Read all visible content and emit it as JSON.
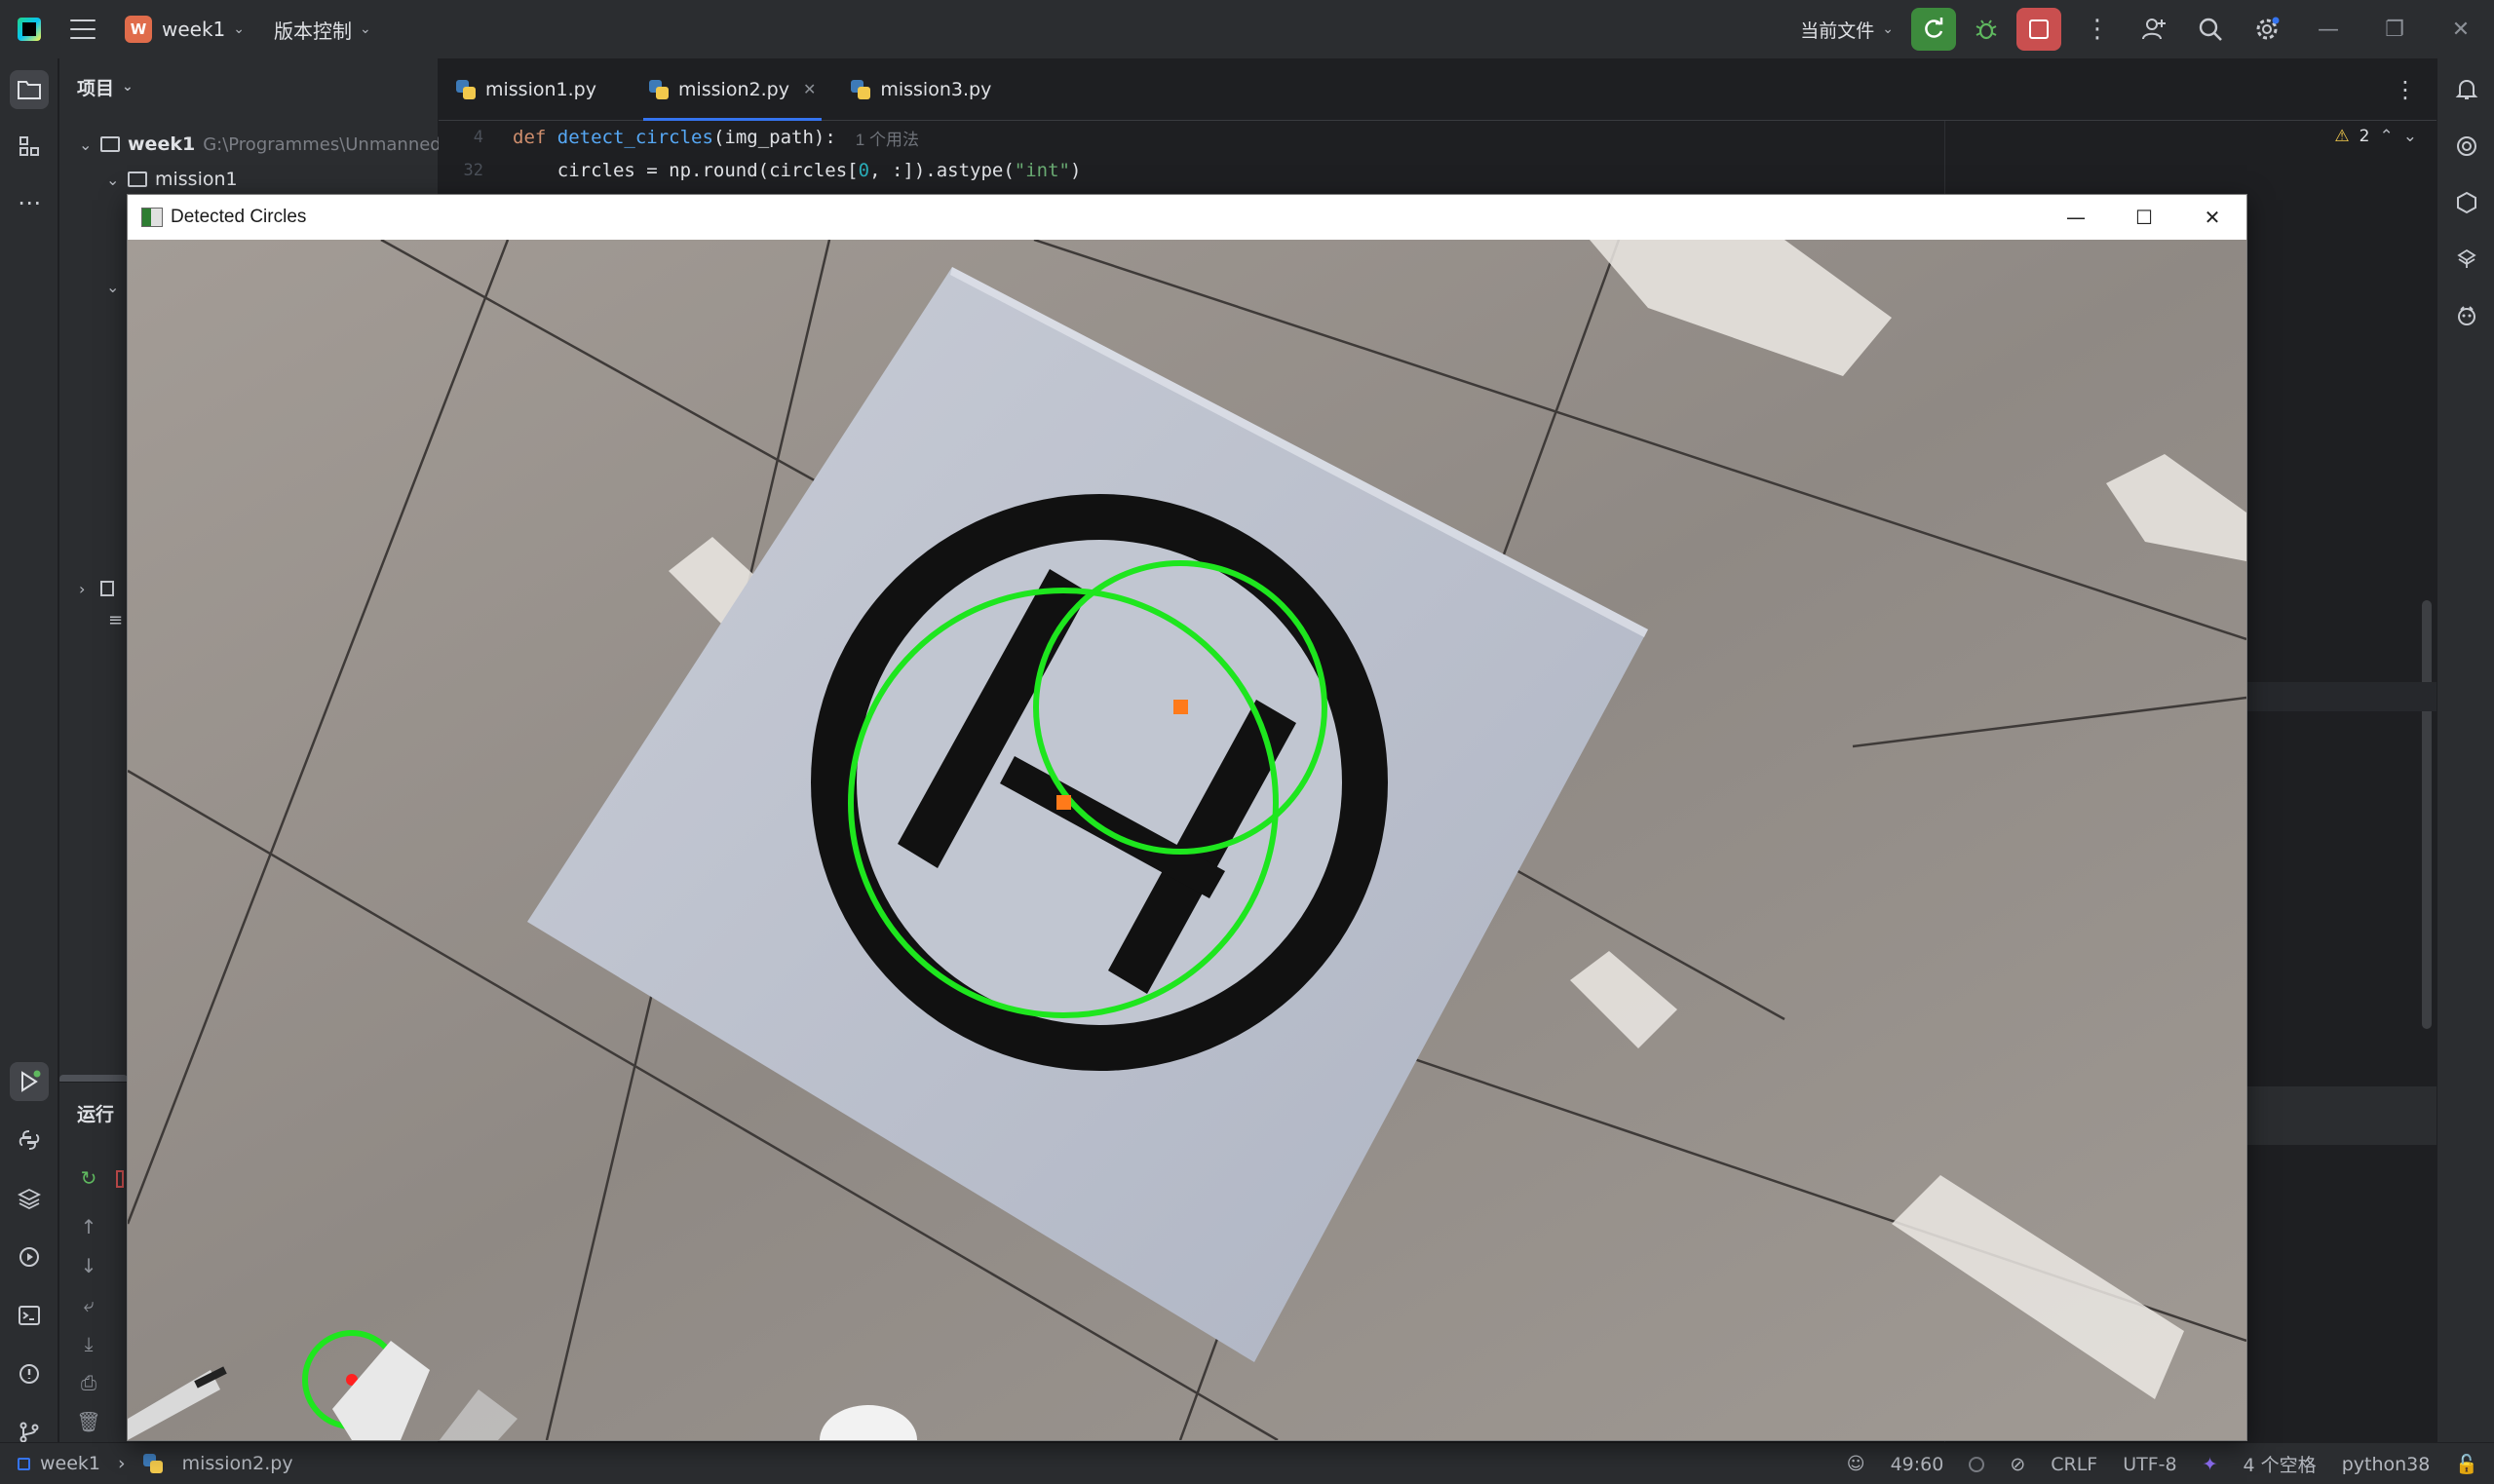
{
  "titlebar": {
    "project_badge": "W",
    "project_name": "week1",
    "vcs_label": "版本控制",
    "current_file_label": "当前文件"
  },
  "project_panel": {
    "header": "项目",
    "root": {
      "name": "week1",
      "path": "G:\\Programmes\\Unmanned/"
    },
    "child": "mission1"
  },
  "run_panel": {
    "title": "运行"
  },
  "tabs": [
    {
      "label": "mission1.py",
      "active": false
    },
    {
      "label": "mission2.py",
      "active": true
    },
    {
      "label": "mission3.py",
      "active": false
    }
  ],
  "code": {
    "line1_no": "4",
    "line1_kw": "def",
    "line1_fn": "detect_circles",
    "line1_rest": "(img_path):",
    "line1_hint": "1 个用法",
    "line2_no": "32",
    "line2_a": "    circles = np.round(circles[",
    "line2_num": "0",
    "line2_b": ", :]).astype(",
    "line2_str": "\"int\"",
    "line2_c": ")"
  },
  "inspection": {
    "warning_count": "2"
  },
  "cv_window": {
    "title": "Detected Circles"
  },
  "statusbar": {
    "project": "week1",
    "file": "mission2.py",
    "position": "49:60",
    "line_sep": "CRLF",
    "encoding": "UTF-8",
    "indent": "4 个空格",
    "interpreter": "python38"
  },
  "colors": {
    "accent": "#3574f0",
    "detection_circle": "#1ee61e",
    "detection_center": "#ff7a1a",
    "small_center": "#ff2020"
  }
}
